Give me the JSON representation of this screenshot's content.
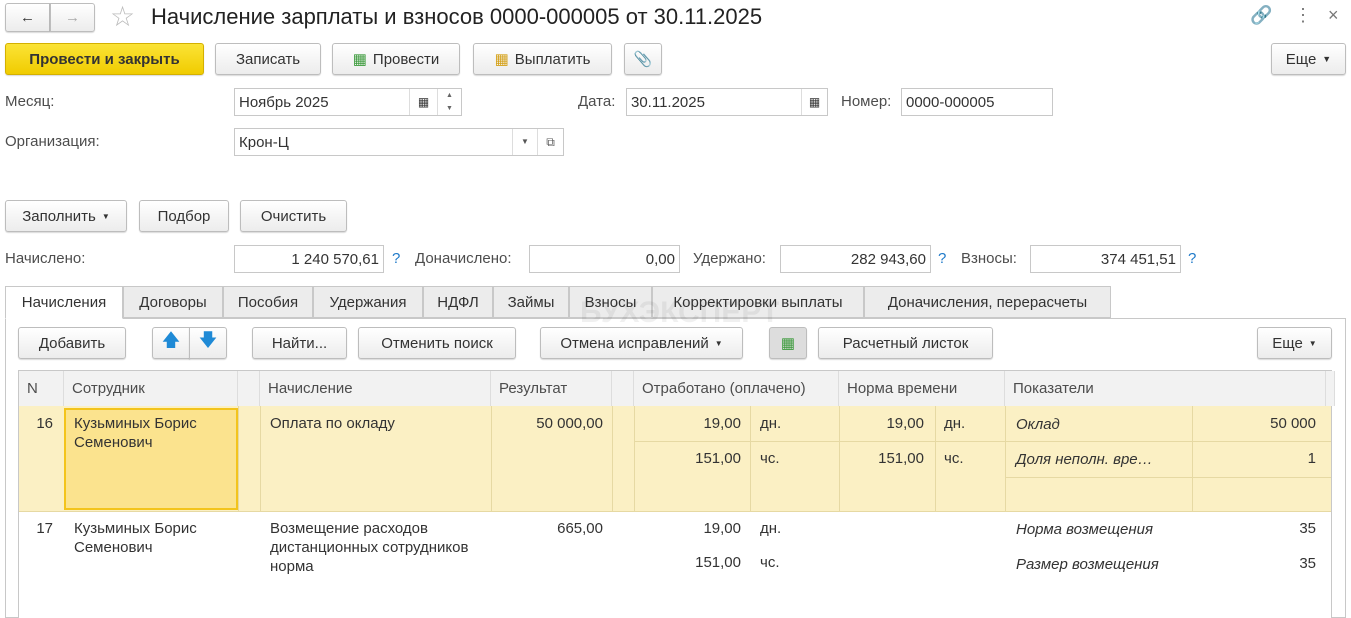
{
  "window": {
    "title": "Начисление зарплаты и взносов 0000-000005 от 30.11.2025"
  },
  "toolbar": {
    "post_close": "Провести и закрыть",
    "save": "Записать",
    "post": "Провести",
    "pay": "Выплатить",
    "more": "Еще"
  },
  "form": {
    "month_label": "Месяц:",
    "month_value": "Ноябрь 2025",
    "date_label": "Дата:",
    "date_value": "30.11.2025",
    "number_label": "Номер:",
    "number_value": "0000-000005",
    "org_label": "Организация:",
    "org_value": "Крон-Ц"
  },
  "actions": {
    "fill": "Заполнить",
    "select": "Подбор",
    "clear": "Очистить"
  },
  "totals": {
    "accrued_label": "Начислено:",
    "accrued": "1 240 570,61",
    "extra_label": "Доначислено:",
    "extra": "0,00",
    "withheld_label": "Удержано:",
    "withheld": "282 943,60",
    "contrib_label": "Взносы:",
    "contrib": "374 451,51",
    "help": "?"
  },
  "tabs": [
    "Начисления",
    "Договоры",
    "Пособия",
    "Удержания",
    "НДФЛ",
    "Займы",
    "Взносы",
    "Корректировки выплаты",
    "Доначисления, перерасчеты"
  ],
  "watermark": "БУХЭКСПЕРТ",
  "table_toolbar": {
    "add": "Добавить",
    "find": "Найти...",
    "cancel_search": "Отменить поиск",
    "cancel_fix": "Отмена исправлений",
    "payslip": "Расчетный листок",
    "more": "Еще"
  },
  "columns": {
    "n": "N",
    "employee": "Сотрудник",
    "accrual": "Начисление",
    "result": "Результат",
    "worked": "Отработано (оплачено)",
    "norm": "Норма времени",
    "indicators": "Показатели"
  },
  "rows": [
    {
      "n": "16",
      "employee": "Кузьминых Борис Семенович",
      "accrual": "Оплата по окладу",
      "result": "50 000,00",
      "worked_days": "19,00",
      "days_unit": "дн.",
      "worked_hours": "151,00",
      "hours_unit": "чс.",
      "norm_days": "19,00",
      "norm_days_unit": "дн.",
      "norm_hours": "151,00",
      "norm_hours_unit": "чс.",
      "ind1_name": "Оклад",
      "ind1_value": "50 000",
      "ind2_name": "Доля неполн. вре…",
      "ind2_value": "1"
    },
    {
      "n": "17",
      "employee": "Кузьминых Борис Семенович",
      "accrual": "Возмещение расходов дистанционных сотрудников норма",
      "result": "665,00",
      "worked_days": "19,00",
      "days_unit": "дн.",
      "worked_hours": "151,00",
      "hours_unit": "чс.",
      "ind1_name": "Норма возмещения",
      "ind1_value": "35",
      "ind2_name": "Размер возмещения",
      "ind2_value": "35"
    }
  ]
}
